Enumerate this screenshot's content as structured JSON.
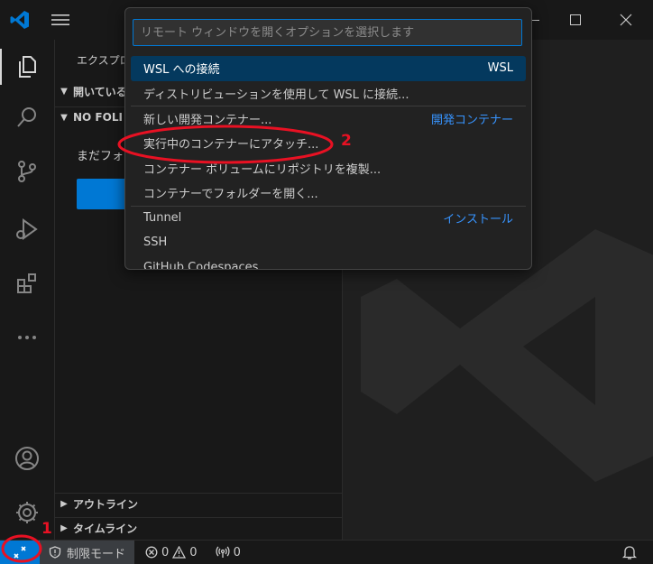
{
  "sidebar": {
    "title": "エクスプロー",
    "sections": {
      "open_editors": "開いている",
      "no_folder": "NO FOLI",
      "outline": "アウトライン",
      "timeline": "タイムライン"
    },
    "no_folder_message": "まだフォル"
  },
  "quick_pick": {
    "placeholder": "リモート ウィンドウを開くオプションを選択します",
    "items": [
      {
        "label": "WSL への接続",
        "aux": "WSL",
        "selected": true
      },
      {
        "label": "ディストリビューションを使用して WSL に接続...",
        "aux": ""
      },
      {
        "label": "新しい開発コンテナー...",
        "aux": "開発コンテナー"
      },
      {
        "label": "実行中のコンテナーにアタッチ...",
        "aux": ""
      },
      {
        "label": "コンテナー ボリュームにリポジトリを複製...",
        "aux": ""
      },
      {
        "label": "コンテナーでフォルダーを開く...",
        "aux": ""
      },
      {
        "label": "Tunnel",
        "aux": "インストール"
      },
      {
        "label": "SSH",
        "aux": ""
      },
      {
        "label": "GitHub Codespaces",
        "aux": ""
      }
    ]
  },
  "statusbar": {
    "restricted_mode": "制限モード",
    "errors": "0",
    "warnings": "0",
    "ports": "0"
  },
  "annotations": {
    "first": "1",
    "second": "2"
  },
  "icons": {
    "logo": "vscode-logo-icon",
    "menu": "hamburger-menu-icon",
    "explorer": "files-icon",
    "search": "search-icon",
    "scm": "source-control-icon",
    "debug": "run-debug-icon",
    "extensions": "extensions-icon",
    "more": "ellipsis-icon",
    "accounts": "account-icon",
    "manage": "gear-icon",
    "remote": "remote-icon",
    "shield": "shield-icon",
    "error": "error-icon",
    "warning": "warning-icon",
    "ports": "broadcast-icon",
    "bell": "bell-icon"
  },
  "colors": {
    "accent": "#0078d4",
    "annotation": "#e81123",
    "link": "#3794ff",
    "selection": "#04395e"
  }
}
